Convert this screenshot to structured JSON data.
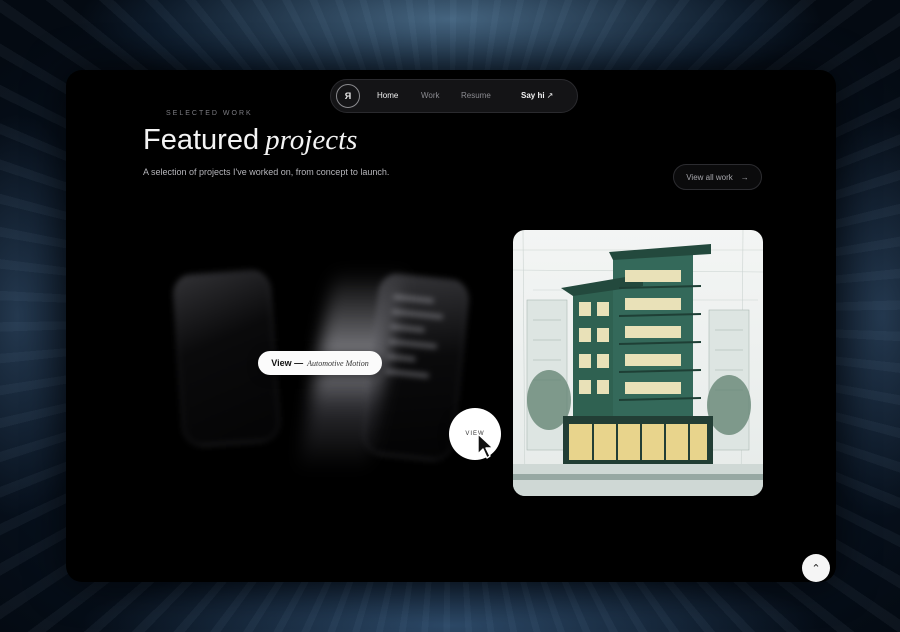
{
  "nav": {
    "logo_text": "Я",
    "home": "Home",
    "work": "Work",
    "resume": "Resume",
    "say_hi": "Say hi",
    "say_hi_arrow": "↗"
  },
  "hero": {
    "eyebrow": "SELECTED WORK",
    "title_plain": "Featured",
    "title_italic": "projects",
    "subtitle": "A selection of projects I've worked on, from concept to launch."
  },
  "view_all": {
    "label": "View all work",
    "arrow": "→"
  },
  "project_hover_pill": {
    "lead": "View —",
    "project": "Automotive Motion"
  },
  "view_circle": {
    "label": "VIEW"
  },
  "scroll_top": {
    "icon": "chevron-up-icon",
    "glyph": "⌃"
  },
  "colors": {
    "window_bg": "#000000",
    "accent": "#f2f2f2",
    "muted": "#8b8b90"
  }
}
